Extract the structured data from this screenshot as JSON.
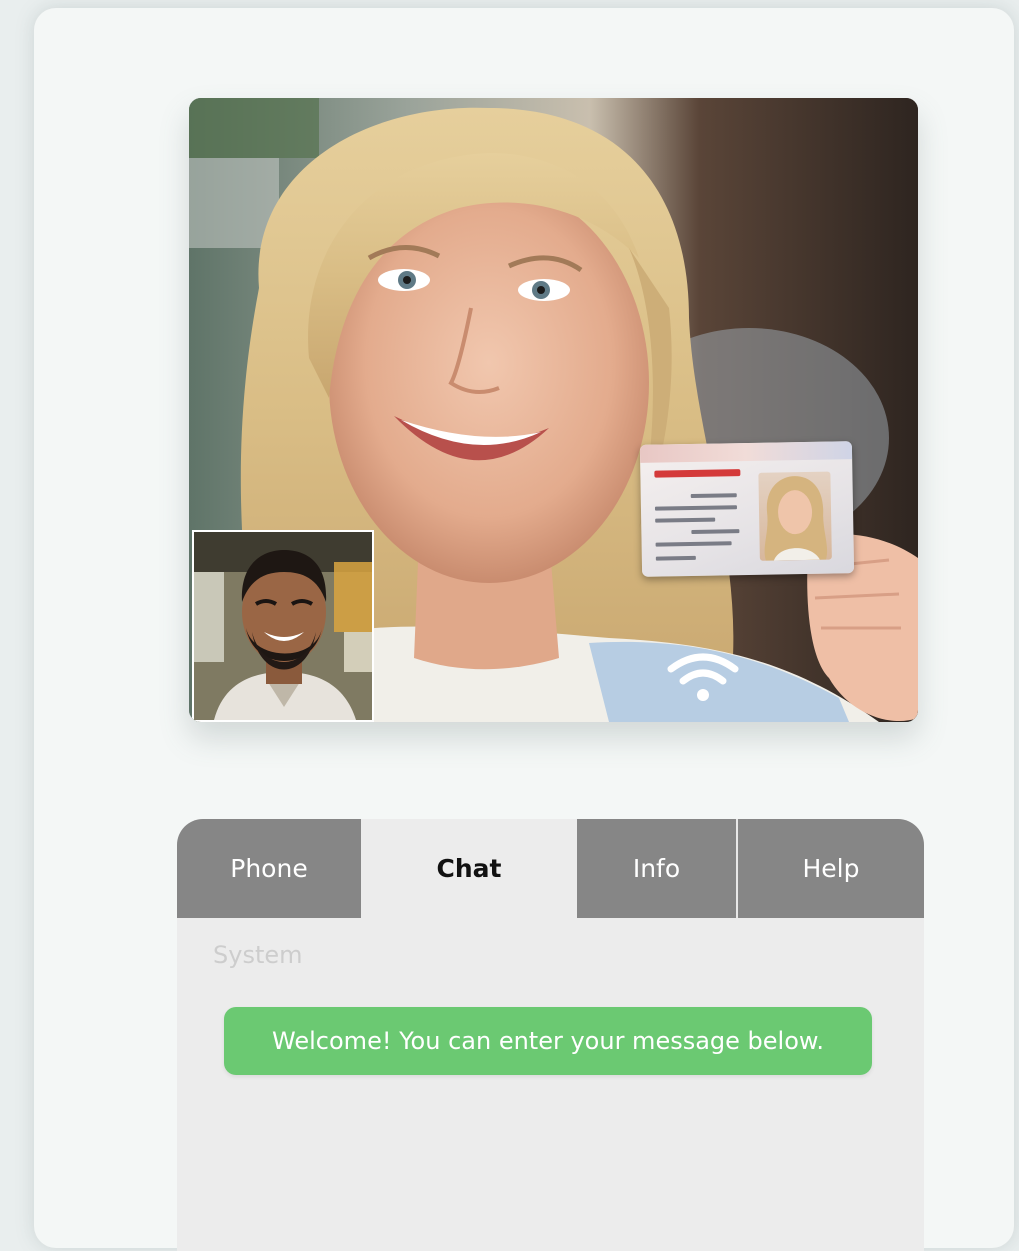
{
  "video": {
    "main_feed": "caller-video-feed",
    "self_view": "self-view-video",
    "id_document": "id-card",
    "connection_icon": "wifi-icon"
  },
  "tabs": [
    {
      "label": "Phone"
    },
    {
      "label": "Chat",
      "active": true
    },
    {
      "label": "Info"
    },
    {
      "label": "Help"
    }
  ],
  "chat": {
    "messages": [
      {
        "sender": "System",
        "text": "Welcome! You can enter your message below."
      }
    ]
  },
  "colors": {
    "tab_inactive": "#868686",
    "tab_active": "#ececec",
    "message_bubble": "#6bc972",
    "panel_background": "#ececec"
  }
}
